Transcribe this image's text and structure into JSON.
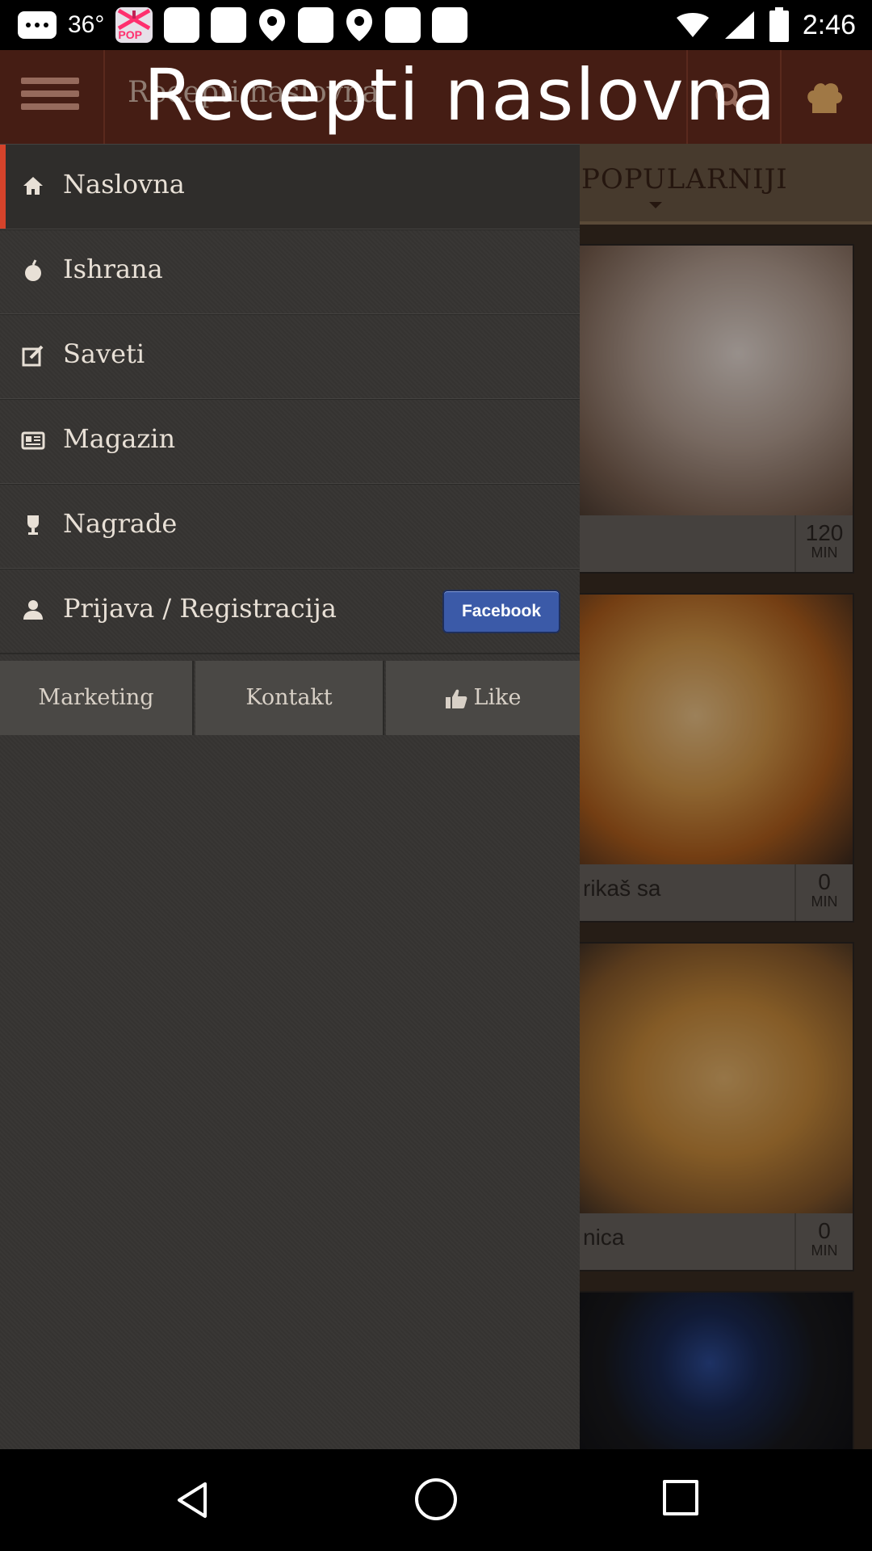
{
  "status_bar": {
    "temperature": "36°",
    "time": "2:46",
    "app_badge": "POP"
  },
  "app_bar": {
    "title": "Recepti naslovna",
    "overlay_title": "Recepti naslovna"
  },
  "tabs": {
    "active": "POPULARNIJI"
  },
  "cards": [
    {
      "name": "",
      "time": "120",
      "unit": "MIN"
    },
    {
      "name": "rikaš sa",
      "time": "0",
      "unit": "MIN"
    },
    {
      "name": "nica",
      "time": "0",
      "unit": "MIN"
    }
  ],
  "drawer": {
    "items": [
      {
        "label": "Naslovna",
        "icon": "home-icon"
      },
      {
        "label": "Ishrana",
        "icon": "apple-icon"
      },
      {
        "label": "Saveti",
        "icon": "edit-icon"
      },
      {
        "label": "Magazin",
        "icon": "newspaper-icon"
      },
      {
        "label": "Nagrade",
        "icon": "trophy-icon"
      },
      {
        "label": "Prijava / Registracija",
        "icon": "user-icon"
      }
    ],
    "facebook_label": "Facebook",
    "footer": {
      "marketing": "Marketing",
      "kontakt": "Kontakt",
      "like": "Like"
    }
  },
  "colors": {
    "accent": "#d5432b",
    "app_bar": "#6a2d1f",
    "drawer": "#363432",
    "facebook": "#3b5aa8"
  }
}
